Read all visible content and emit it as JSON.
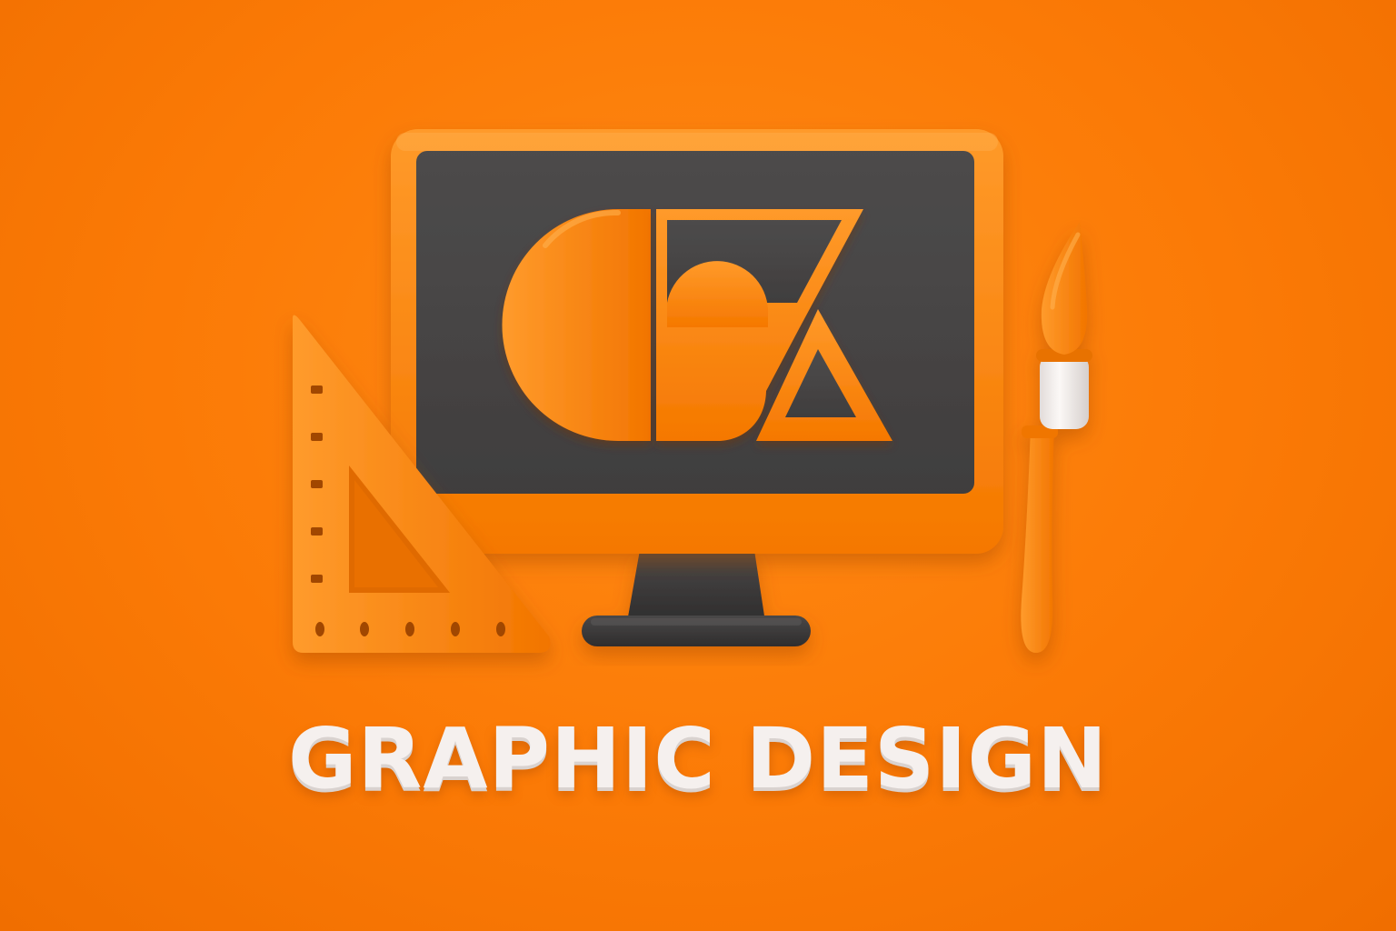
{
  "caption": {
    "text": "GRAPHIC DESIGN"
  },
  "illustration": {
    "icons": [
      "monitor-icon",
      "set-square-ruler-icon",
      "paintbrush-icon",
      "semicircle-shape-icon",
      "square-shape-icon",
      "triangle-shape-icon"
    ]
  },
  "colors": {
    "background": "#fb7a06",
    "accent_orange": "#ff8a14",
    "screen_dark": "#474545",
    "stand_dark": "#3a3838",
    "caption_white": "#f5f0ee",
    "brush_ferrule": "#f2eeec"
  }
}
